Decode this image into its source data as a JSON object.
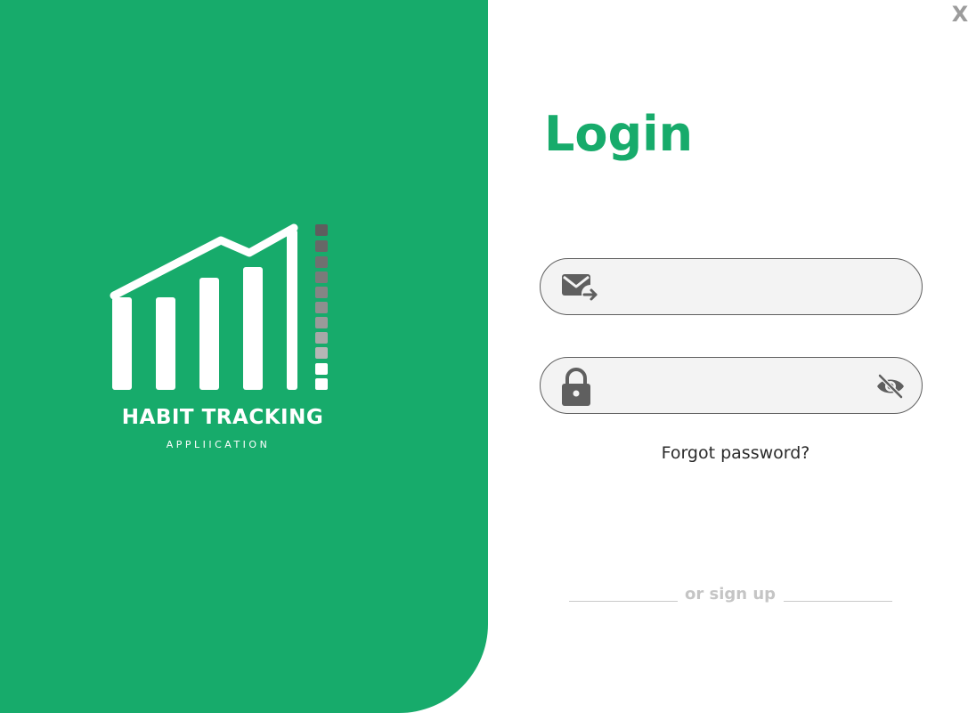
{
  "window": {
    "close_label": "X"
  },
  "brand": {
    "title": "HABIT TRACKING",
    "subtitle": "APPLIICATION",
    "logo_icon": "rising-bar-chart-logo"
  },
  "login": {
    "title": "Login",
    "email": {
      "icon": "mail-forward-icon",
      "value": "",
      "placeholder": ""
    },
    "password": {
      "icon": "lock-icon",
      "toggle_icon": "eye-off-icon",
      "value": "",
      "placeholder": ""
    },
    "forgot_label": "Forgot password?",
    "signup_label": "or sign up"
  },
  "colors": {
    "brand_green": "#17ab6b",
    "input_bg": "#f3f3f3",
    "icon_gray": "#5f5f5f",
    "muted_text": "#c5c5c5"
  }
}
